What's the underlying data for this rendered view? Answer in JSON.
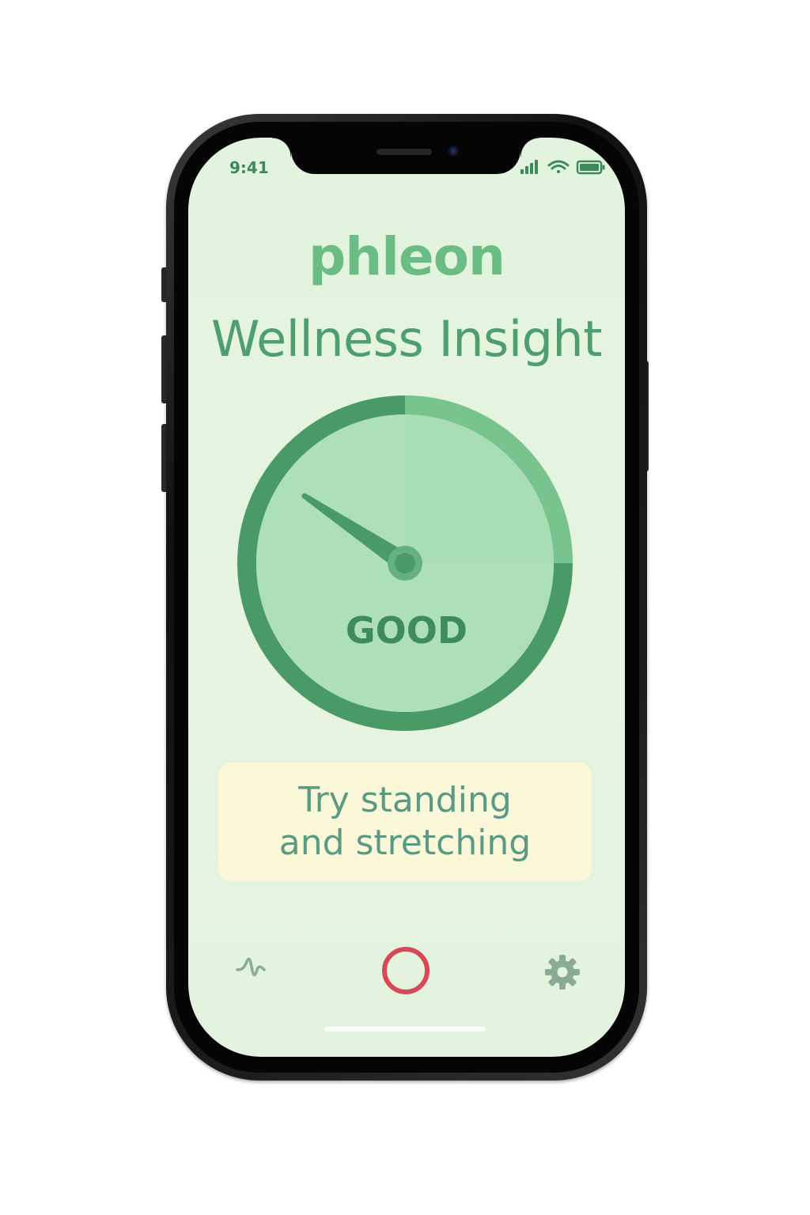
{
  "status_bar": {
    "time": "9:41",
    "icons": [
      "signal-icon",
      "wifi-icon",
      "battery-icon"
    ]
  },
  "app": {
    "brand": "phleon",
    "title": "Wellness Insight"
  },
  "gauge": {
    "status_label": "GOOD",
    "needle_angle_deg": 300
  },
  "tip": {
    "text": "Try standing and stretching"
  },
  "tab_bar": {
    "items": [
      {
        "icon": "activity-wave-icon"
      },
      {
        "icon": "record-circle-icon"
      },
      {
        "icon": "gear-icon"
      }
    ]
  },
  "colors": {
    "accent": "#6cbc86",
    "title": "#4e9e6e",
    "gauge_dark": "#4a9a68",
    "gauge_light": "#78c48e",
    "gauge_face": "#ade0b8",
    "tip_background": "#faf8d8",
    "record_button": "#d64a58",
    "inactive_icon": "#8aab96"
  }
}
